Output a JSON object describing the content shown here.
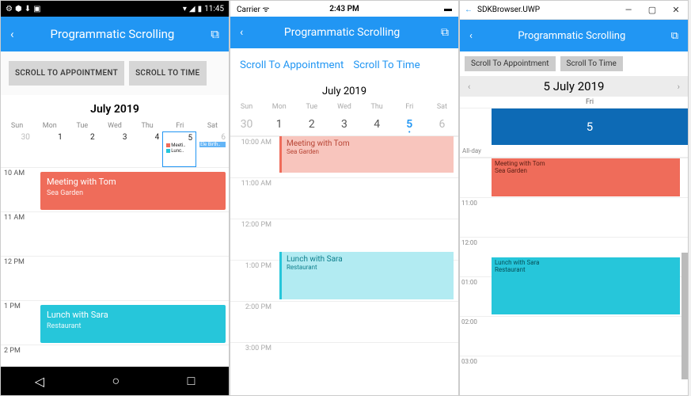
{
  "android": {
    "statusbar": {
      "time": "11:45"
    },
    "header": {
      "title": "Programmatic Scrolling"
    },
    "buttons": {
      "appt": "SCROLL TO APPOINTMENT",
      "time": "SCROLL TO TIME"
    },
    "month": "July 2019",
    "days_header": [
      "Sun",
      "Mon",
      "Tue",
      "Wed",
      "Thu",
      "Fri",
      "Sat"
    ],
    "days_row": [
      "30",
      "1",
      "2",
      "3",
      "4",
      "5",
      "6"
    ],
    "chips": {
      "meeti": "Meeti..",
      "lunc": "Lunc..",
      "ele": "Ele Birth.."
    },
    "times": [
      "10 AM",
      "11 AM",
      "12 PM",
      "1 PM",
      "2 PM"
    ],
    "appt1": {
      "title": "Meeting with Tom",
      "loc": "Sea Garden"
    },
    "appt2": {
      "title": "Lunch with Sara",
      "loc": "Restaurant"
    }
  },
  "ios": {
    "statusbar": {
      "carrier": "Carrier",
      "time": "2:43 PM"
    },
    "header": {
      "title": "Programmatic Scrolling"
    },
    "buttons": {
      "appt": "Scroll To Appointment",
      "time": "Scroll To Time"
    },
    "month": "July 2019",
    "days_header": [
      "Sun",
      "Mon",
      "Tue",
      "Wed",
      "Thu",
      "Fri",
      "Sat"
    ],
    "days_row": [
      "30",
      "1",
      "2",
      "3",
      "4",
      "5",
      "6"
    ],
    "times": [
      "10:00 AM",
      "11:00 AM",
      "12:00 PM",
      "1:00 PM",
      "2:00 PM",
      "3:00 PM"
    ],
    "appt1": {
      "title": "Meeting with Tom",
      "loc": "Sea Garden"
    },
    "appt2": {
      "title": "Lunch with Sara",
      "loc": "Restaurant"
    }
  },
  "uwp": {
    "titlebar": {
      "app": "SDKBrowser.UWP"
    },
    "header": {
      "title": "Programmatic Scrolling"
    },
    "buttons": {
      "appt": "Scroll To Appointment",
      "time": "Scroll To Time"
    },
    "nav_date": "5 July 2019",
    "dayhdr": "Fri",
    "daynum": "5",
    "allday": "All-day",
    "times": [
      "",
      "11:00",
      "12:00",
      "01:00",
      "02:00",
      "03:00"
    ],
    "appt1": {
      "title": "Meeting with Tom",
      "loc": "Sea Garden"
    },
    "appt2": {
      "title": "Lunch with Sara",
      "loc": "Restaurant"
    }
  }
}
